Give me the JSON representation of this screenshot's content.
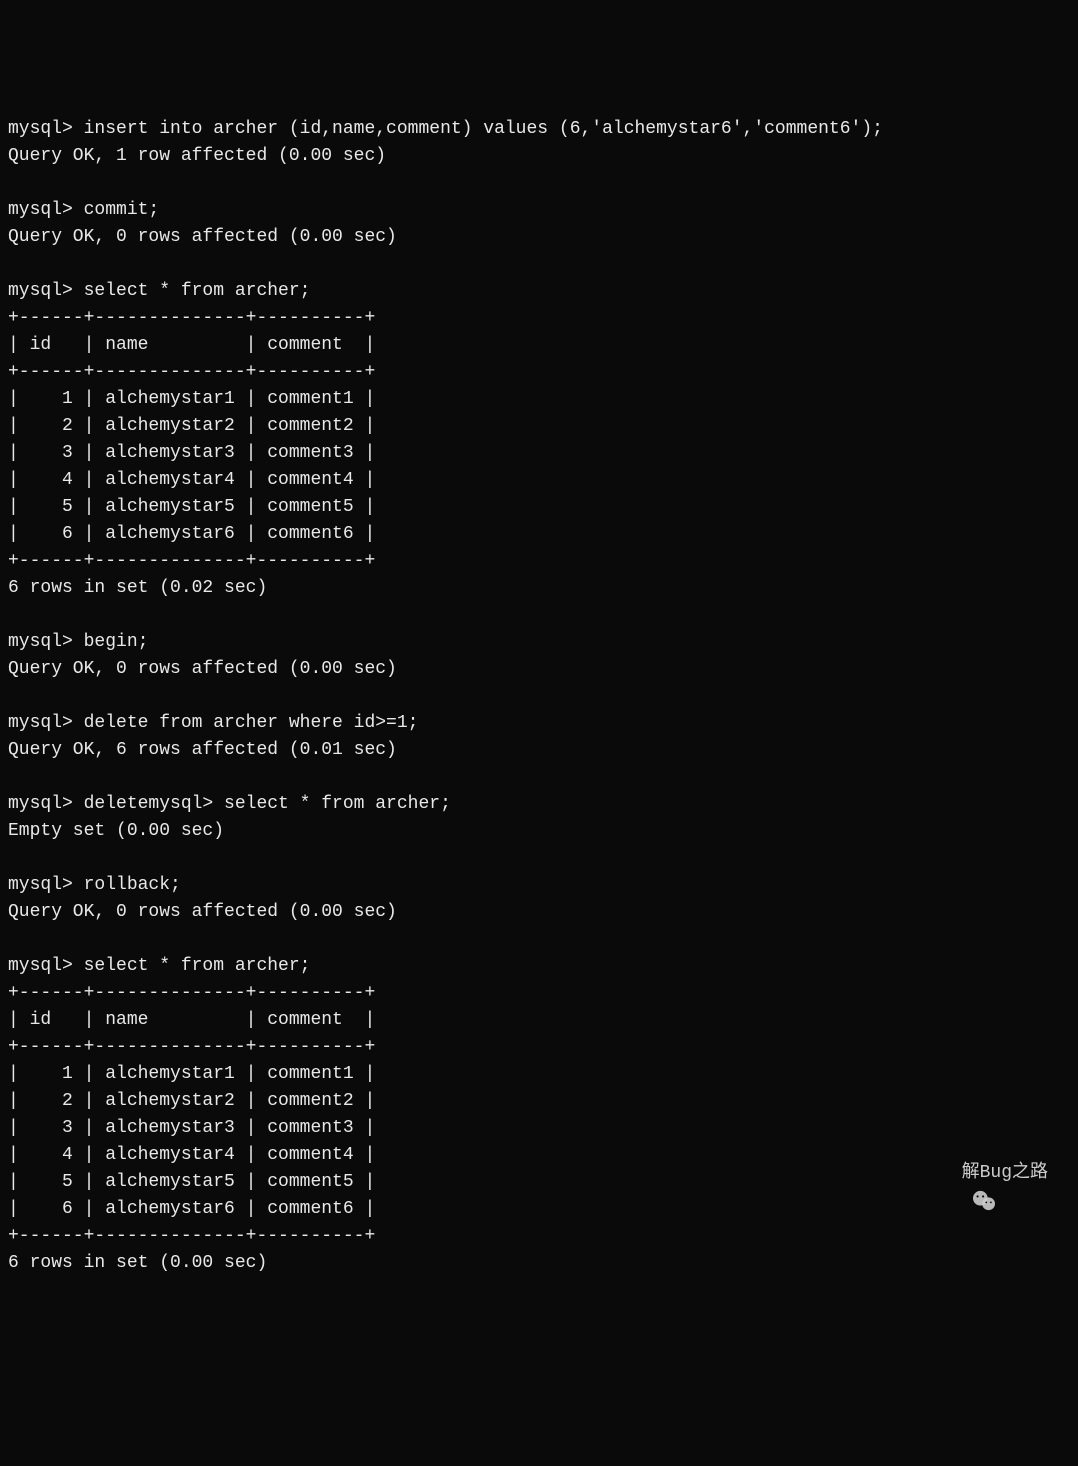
{
  "terminal": {
    "prompt": "mysql>",
    "lines": [
      "mysql> insert into archer (id,name,comment) values (6,'alchemystar6','comment6');",
      "Query OK, 1 row affected (0.00 sec)",
      "",
      "mysql> commit;",
      "Query OK, 0 rows affected (0.00 sec)",
      "",
      "mysql> select * from archer;",
      "+------+--------------+----------+",
      "| id   | name         | comment  |",
      "+------+--------------+----------+",
      "|    1 | alchemystar1 | comment1 |",
      "|    2 | alchemystar2 | comment2 |",
      "|    3 | alchemystar3 | comment3 |",
      "|    4 | alchemystar4 | comment4 |",
      "|    5 | alchemystar5 | comment5 |",
      "|    6 | alchemystar6 | comment6 |",
      "+------+--------------+----------+",
      "6 rows in set (0.02 sec)",
      "",
      "mysql> begin;",
      "Query OK, 0 rows affected (0.00 sec)",
      "",
      "mysql> delete from archer where id>=1;",
      "Query OK, 6 rows affected (0.01 sec)",
      "",
      "mysql> deletemysql> select * from archer;",
      "Empty set (0.00 sec)",
      "",
      "mysql> rollback;",
      "Query OK, 0 rows affected (0.00 sec)",
      "",
      "mysql> select * from archer;",
      "+------+--------------+----------+",
      "| id   | name         | comment  |",
      "+------+--------------+----------+",
      "|    1 | alchemystar1 | comment1 |",
      "|    2 | alchemystar2 | comment2 |",
      "|    3 | alchemystar3 | comment3 |",
      "|    4 | alchemystar4 | comment4 |",
      "|    5 | alchemystar5 | comment5 |",
      "|    6 | alchemystar6 | comment6 |",
      "+------+--------------+----------+",
      "6 rows in set (0.00 sec)"
    ]
  },
  "watermark": {
    "text": "解Bug之路"
  }
}
